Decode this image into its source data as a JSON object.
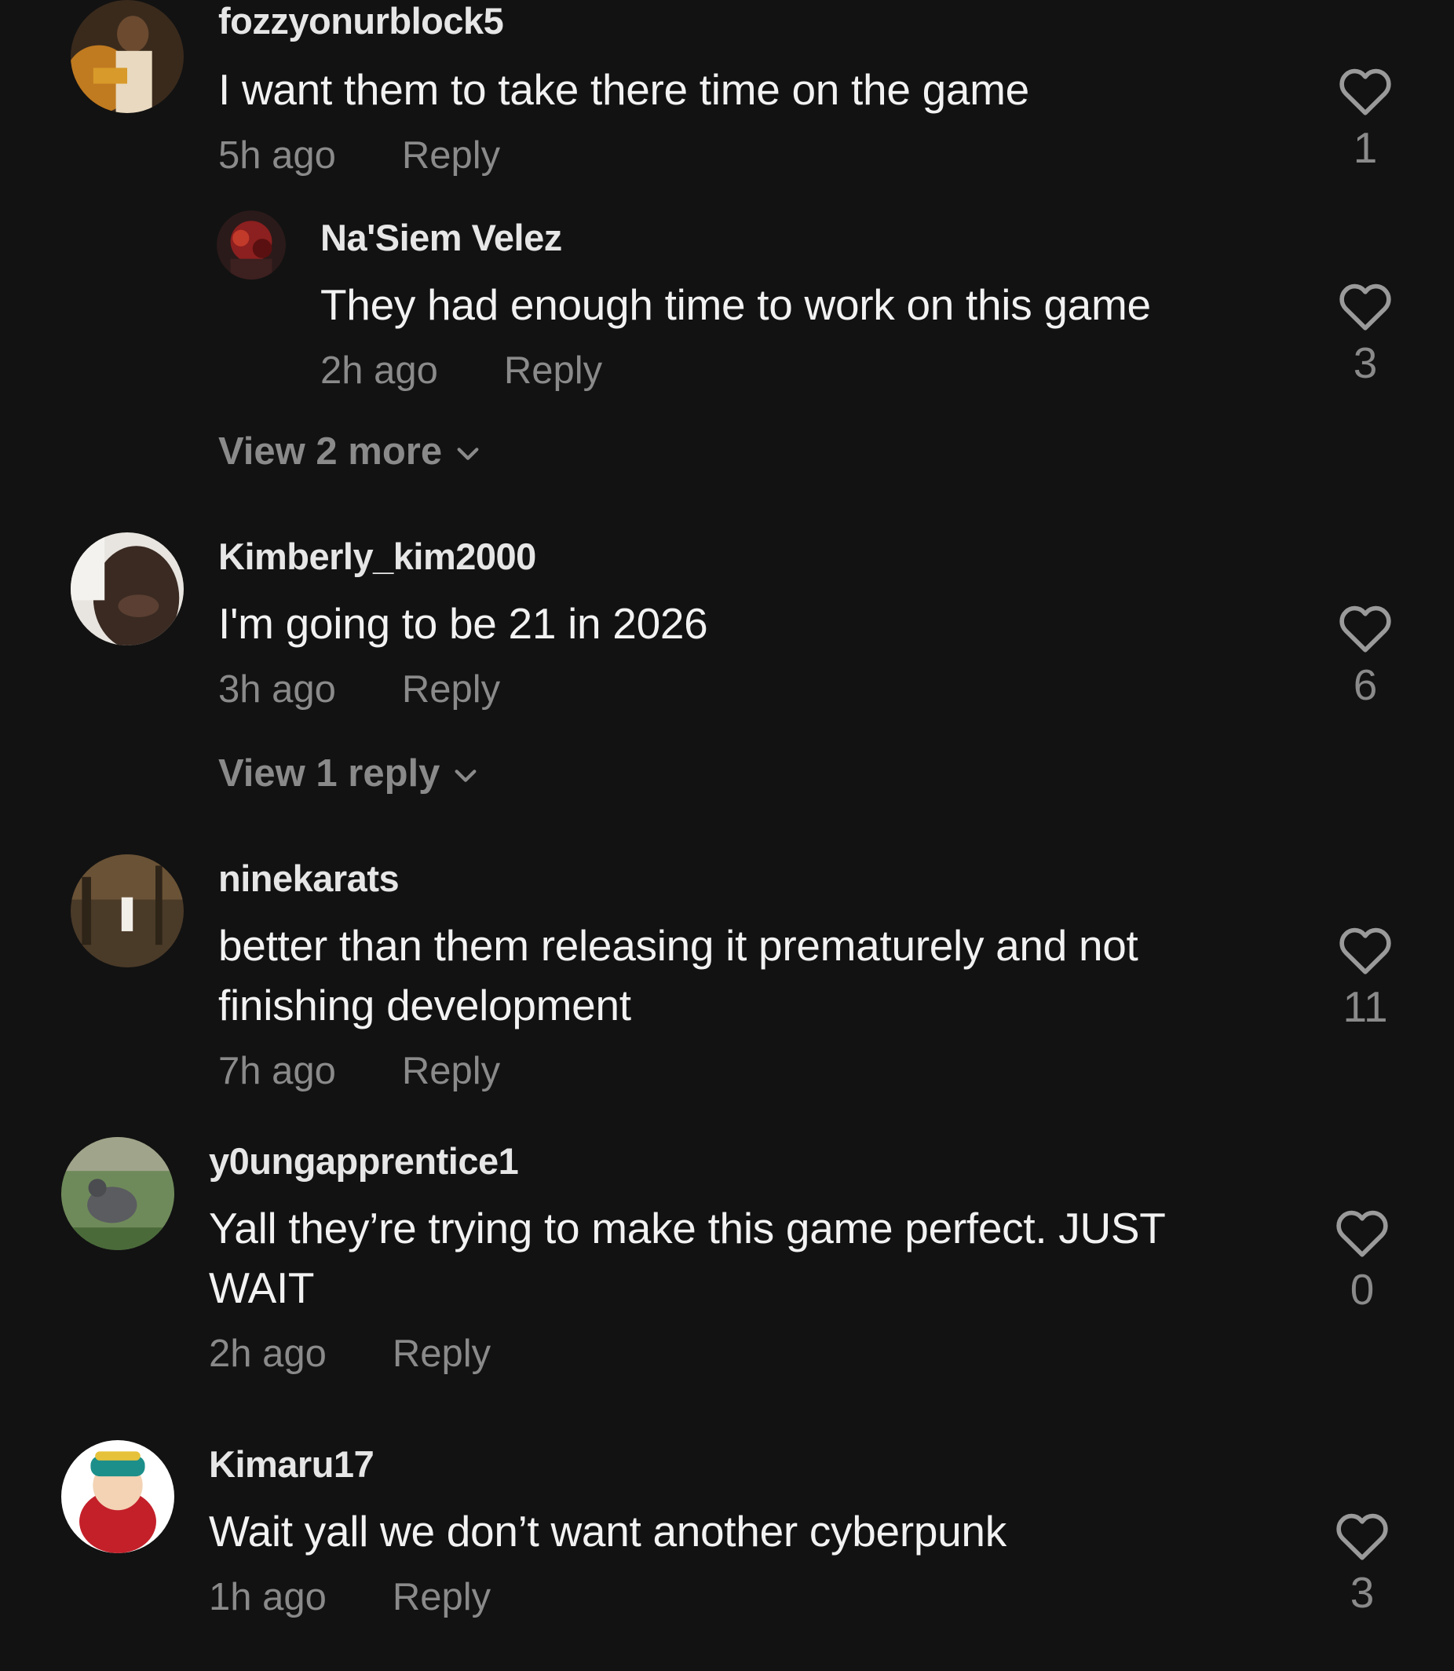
{
  "comments": [
    {
      "username": "fozzyonurblock5",
      "text": "I want them to take there time on the game",
      "time": "5h ago",
      "reply": "Reply",
      "likes": "1"
    },
    {
      "username": "Na'Siem Velez",
      "text": "They had enough time to work on this game",
      "time": "2h ago",
      "reply": "Reply",
      "likes": "3"
    },
    {
      "username": "Kimberly_kim2000",
      "text": "I'm going to be 21 in 2026",
      "time": "3h ago",
      "reply": "Reply",
      "likes": "6"
    },
    {
      "username": "ninekarats",
      "text": "better than them releasing it prematurely and not finishing development",
      "time": "7h ago",
      "reply": "Reply",
      "likes": "11"
    },
    {
      "username": "y0ungapprentice1",
      "text": "Yall they’re trying to make this game perfect. JUST WAIT",
      "time": "2h ago",
      "reply": "Reply",
      "likes": "0"
    },
    {
      "username": "Kimaru17",
      "text": "Wait yall we don’t want another cyberpunk",
      "time": "1h ago",
      "reply": "Reply",
      "likes": "3"
    }
  ],
  "view_more": [
    "View 2 more",
    "View 1 reply"
  ],
  "icons": {
    "like": "heart-outline-icon",
    "expand": "chevron-down-icon"
  },
  "colors": {
    "background": "#121212",
    "primary_text": "#f2f2f2",
    "secondary_text": "#8a8a8a"
  }
}
